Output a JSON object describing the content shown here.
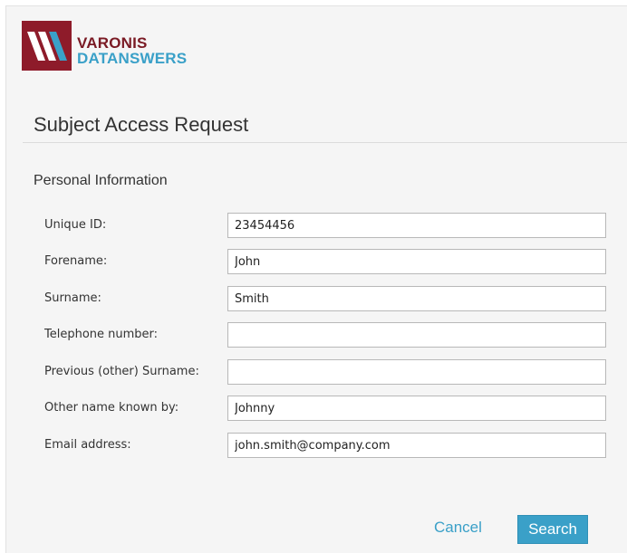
{
  "brand": {
    "line1": "VARONIS",
    "line2": "DATANSWERS",
    "logo_icon": "varonis-logo-icon",
    "colors": {
      "primary": "#7a1a24",
      "accent": "#3aa0c8"
    }
  },
  "page": {
    "title": "Subject Access Request"
  },
  "section": {
    "title": "Personal Information"
  },
  "fields": [
    {
      "label": "Unique ID:",
      "value": "23454456",
      "placeholder": ""
    },
    {
      "label": "Forename:",
      "value": "John",
      "placeholder": ""
    },
    {
      "label": "Surname:",
      "value": "Smith",
      "placeholder": ""
    },
    {
      "label": "Telephone number:",
      "value": "",
      "placeholder": ""
    },
    {
      "label": "Previous (other) Surname:",
      "value": "",
      "placeholder": ""
    },
    {
      "label": "Other name known by:",
      "value": "Johnny",
      "placeholder": ""
    },
    {
      "label": "Email address:",
      "value": "john.smith@company.com",
      "placeholder": ""
    }
  ],
  "actions": {
    "cancel_label": "Cancel",
    "search_label": "Search"
  }
}
